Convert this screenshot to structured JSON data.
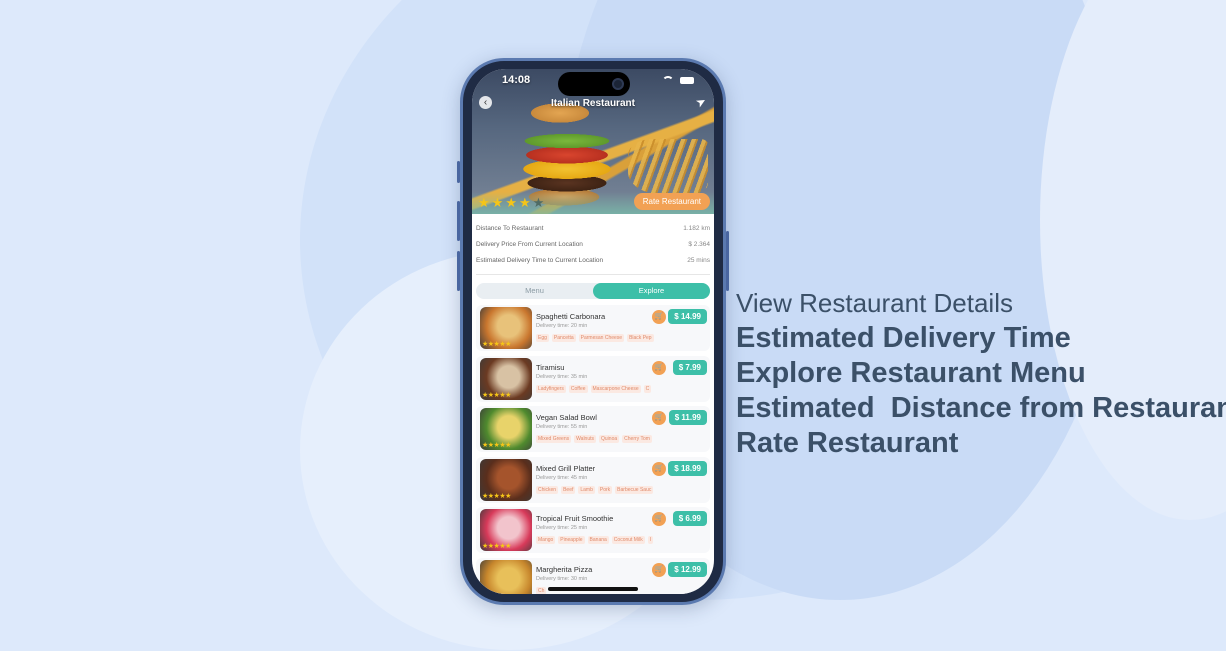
{
  "status_bar": {
    "time": "14:08"
  },
  "header": {
    "title": "Italian Restaurant"
  },
  "rating": {
    "value": 4,
    "max": 5,
    "rate_button_label": "Rate Restaurant"
  },
  "info": [
    {
      "label": "Distance To Restaurant",
      "value": "1.182 km"
    },
    {
      "label": "Delivery Price From Current Location",
      "value": "$ 2.364"
    },
    {
      "label": "Estimated Delivery Time to Current Location",
      "value": "25 mins"
    }
  ],
  "tabs": [
    {
      "label": "Menu",
      "active": false
    },
    {
      "label": "Explore",
      "active": true
    }
  ],
  "menu_items": [
    {
      "name": "Spaghetti Carbonara",
      "time": "Delivery time: 20 min",
      "price": "$ 14.99",
      "tags": [
        "Egg",
        "Pancetta",
        "Parmesan Cheese",
        "Black Pep"
      ],
      "colors": [
        "#c9762e",
        "#e8c27a"
      ]
    },
    {
      "name": "Tiramisu",
      "time": "Delivery time: 35 min",
      "price": "$ 7.99",
      "tags": [
        "Ladyfingers",
        "Coffee",
        "Mascarpone Cheese",
        "C"
      ],
      "colors": [
        "#6b3a22",
        "#d8c2a4"
      ]
    },
    {
      "name": "Vegan Salad Bowl",
      "time": "Delivery time: 55 min",
      "price": "$ 11.99",
      "tags": [
        "Mixed Greens",
        "Walnuts",
        "Quinoa",
        "Cherry Tom"
      ],
      "colors": [
        "#4f8a2e",
        "#e8d36a"
      ]
    },
    {
      "name": "Mixed Grill Platter",
      "time": "Delivery time: 45 min",
      "price": "$ 18.99",
      "tags": [
        "Chicken",
        "Beef",
        "Lamb",
        "Pork",
        "Barbecue Sauc"
      ],
      "colors": [
        "#5a2e1c",
        "#a5542c"
      ]
    },
    {
      "name": "Tropical Fruit Smoothie",
      "time": "Delivery time: 25 min",
      "price": "$ 6.99",
      "tags": [
        "Mango",
        "Pineapple",
        "Banana",
        "Coconut Milk",
        "I"
      ],
      "colors": [
        "#d83a5a",
        "#f2c4cc"
      ]
    },
    {
      "name": "Margherita Pizza",
      "time": "Delivery time: 30 min",
      "price": "$ 12.99",
      "tags": [
        "Ch"
      ],
      "colors": [
        "#c7862c",
        "#e8c05a"
      ]
    }
  ],
  "features": {
    "intro": "View Restaurant Details",
    "items": [
      "Estimated Delivery Time",
      "Explore Restaurant Menu",
      "Estimated  Distance from Restaurant",
      "Rate Restaurant"
    ]
  },
  "colors": {
    "accent": "#3dbfa8",
    "orange": "#f2a154",
    "heading": "#3b5068"
  },
  "icons": [
    "back-icon",
    "navigation-arrow-icon",
    "cart-icon",
    "star-icon",
    "wifi-icon",
    "battery-icon"
  ]
}
